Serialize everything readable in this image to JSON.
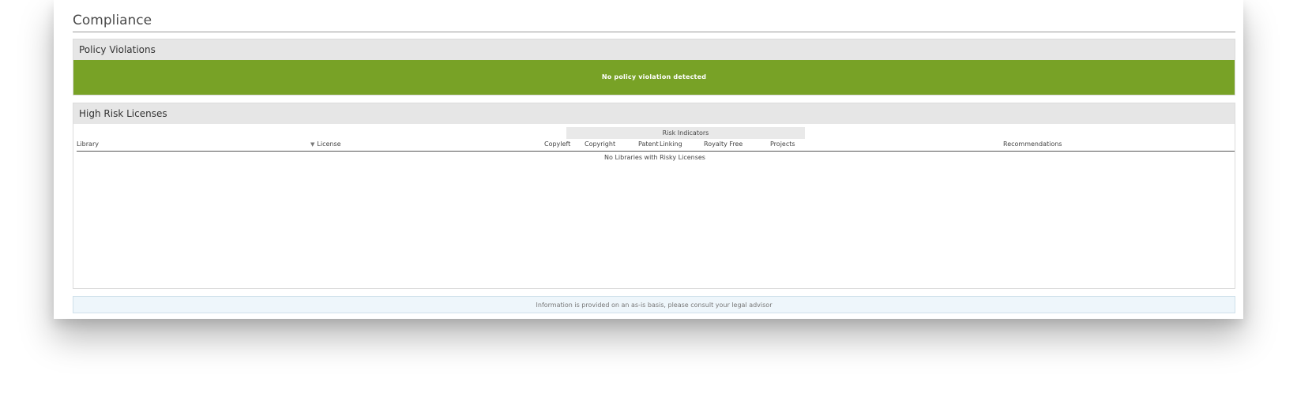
{
  "page": {
    "title": "Compliance"
  },
  "policy_violations": {
    "header": "Policy Violations",
    "status_message": "No policy violation detected",
    "status_color": "#78a226"
  },
  "high_risk_licenses": {
    "header": "High Risk Licenses",
    "risk_group_label": "Risk Indicators",
    "columns": {
      "library": "Library",
      "license": "License",
      "copyleft": "Copyleft",
      "copyright": "Copyright",
      "patent": "Patent",
      "linking": "Linking",
      "royalty_free": "Royalty Free",
      "projects": "Projects",
      "recommendations": "Recommendations"
    },
    "sort_icon": "triangle-down-icon",
    "empty_message": "No Libraries with Risky Licenses"
  },
  "footer": {
    "disclaimer": "Information is provided on an as-is basis, please consult your legal advisor"
  }
}
